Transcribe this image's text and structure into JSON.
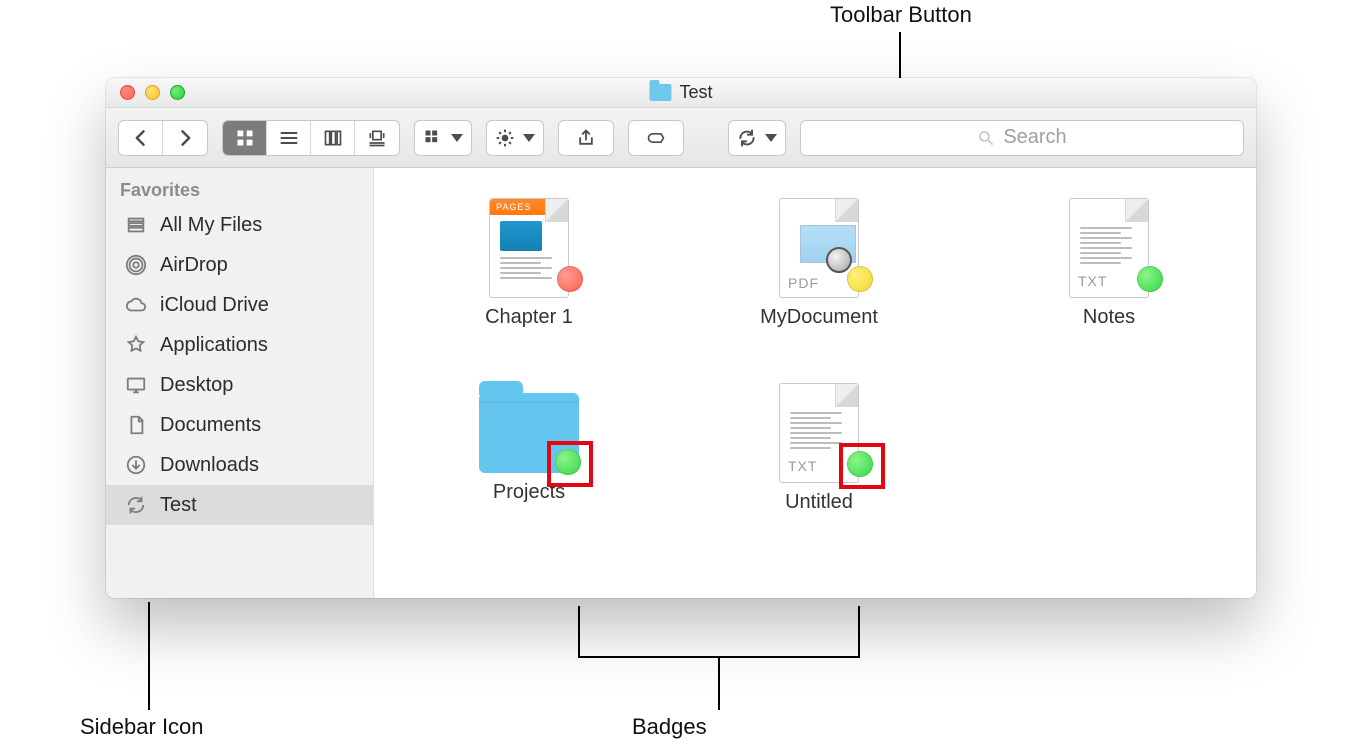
{
  "annotations": {
    "toolbar_button": "Toolbar Button",
    "sidebar_icon": "Sidebar Icon",
    "badges": "Badges"
  },
  "window": {
    "title": "Test"
  },
  "toolbar": {
    "search_placeholder": "Search"
  },
  "sidebar": {
    "heading": "Favorites",
    "items": [
      {
        "label": "All My Files",
        "icon": "all-my-files"
      },
      {
        "label": "AirDrop",
        "icon": "airdrop"
      },
      {
        "label": "iCloud Drive",
        "icon": "icloud"
      },
      {
        "label": "Applications",
        "icon": "applications"
      },
      {
        "label": "Desktop",
        "icon": "desktop"
      },
      {
        "label": "Documents",
        "icon": "documents"
      },
      {
        "label": "Downloads",
        "icon": "downloads"
      },
      {
        "label": "Test",
        "icon": "refresh",
        "selected": true
      }
    ]
  },
  "files": {
    "row1": [
      {
        "name": "Chapter 1",
        "kind": "pages",
        "badge": "red"
      },
      {
        "name": "MyDocument",
        "kind": "pdf",
        "badge": "yellow",
        "ext_label": "PDF"
      },
      {
        "name": "Notes",
        "kind": "txt",
        "badge": "green",
        "ext_label": "TXT"
      }
    ],
    "row2": [
      {
        "name": "Projects",
        "kind": "folder",
        "badge": "green",
        "highlighted": true
      },
      {
        "name": "Untitled",
        "kind": "txt",
        "badge": "green",
        "ext_label": "TXT",
        "highlighted": true
      }
    ]
  }
}
